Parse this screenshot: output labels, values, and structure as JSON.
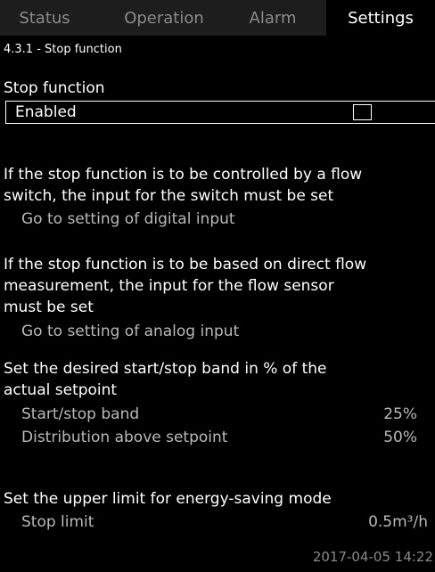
{
  "tabs": [
    "Status",
    "Operation",
    "Alarm",
    "Settings"
  ],
  "page_title": "4.3.1 - Stop function",
  "stop_function": {
    "heading": "Stop function",
    "value": "Enabled"
  },
  "flow_switch": {
    "text_line1": "If the stop function is to be controlled by a flow",
    "text_line2": "switch, the input for the switch must be set",
    "link": "Go to setting of digital input"
  },
  "flow_measurement": {
    "text_line1": "If the stop function is to be based on direct flow",
    "text_line2": "measurement, the input for the flow sensor",
    "text_line3": "must be set",
    "link": "Go to setting of analog input"
  },
  "band": {
    "text_line1": "Set the desired start/stop band in % of the",
    "text_line2": "actual setpoint",
    "start_stop_label": "Start/stop band",
    "start_stop_value": "25%",
    "distribution_label": "Distribution above setpoint",
    "distribution_value": "50%"
  },
  "energy_saving": {
    "text": "Set the upper limit for energy-saving mode",
    "stop_limit_label": "Stop limit",
    "stop_limit_value": "0.5m³/h"
  },
  "timestamp": "2017-04-05 14:22"
}
